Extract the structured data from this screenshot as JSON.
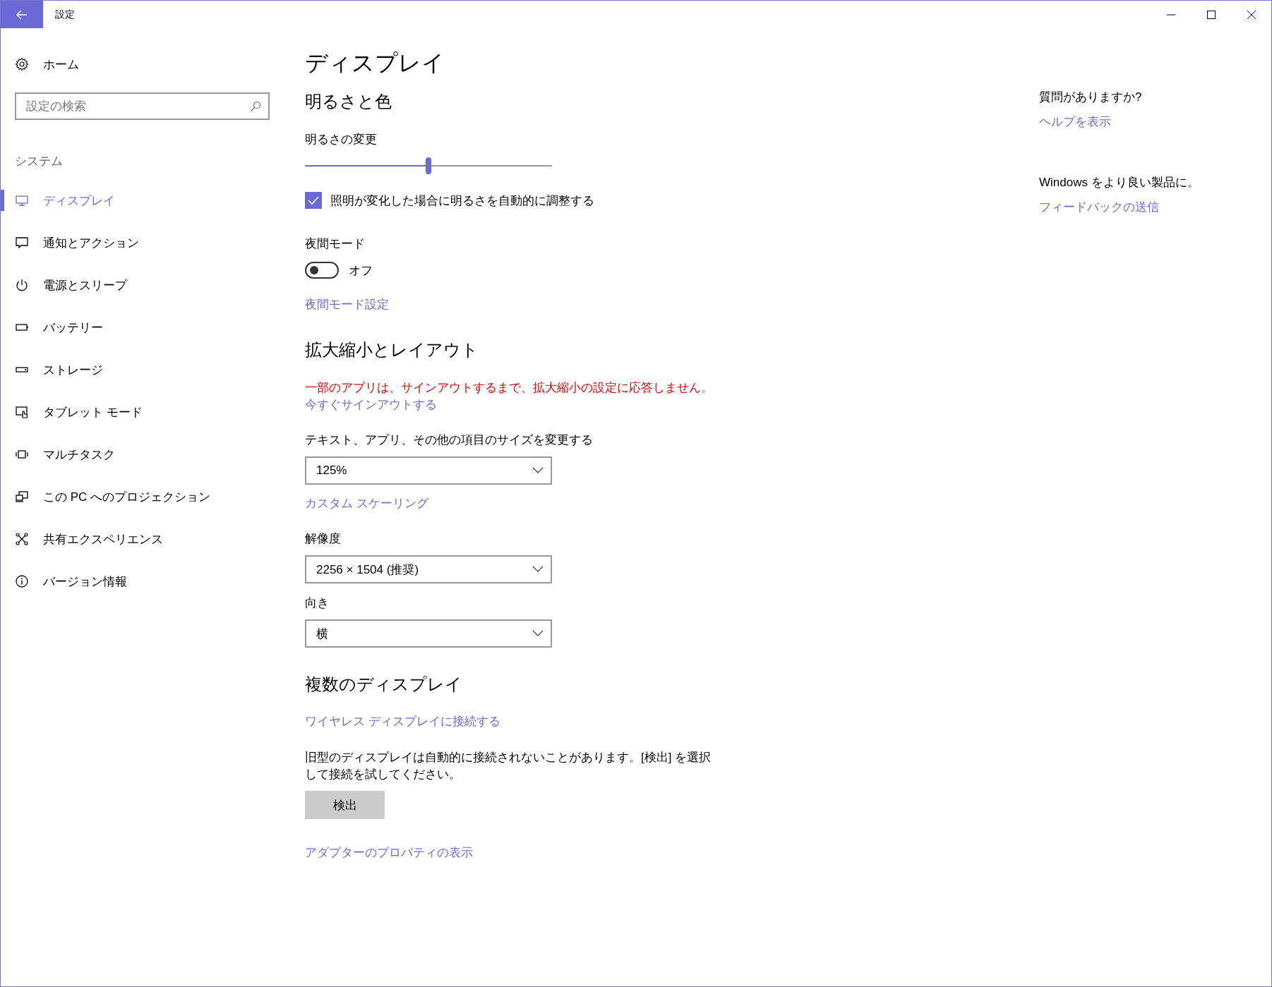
{
  "window": {
    "title": "設定"
  },
  "sidebar": {
    "home": "ホーム",
    "search": {
      "placeholder": "設定の検索"
    },
    "group_label": "システム",
    "items": [
      {
        "label": "ディスプレイ",
        "selected": true,
        "kind": "monitor"
      },
      {
        "label": "通知とアクション",
        "selected": false,
        "kind": "message"
      },
      {
        "label": "電源とスリープ",
        "selected": false,
        "kind": "power"
      },
      {
        "label": "バッテリー",
        "selected": false,
        "kind": "battery"
      },
      {
        "label": "ストレージ",
        "selected": false,
        "kind": "storage"
      },
      {
        "label": "タブレット モード",
        "selected": false,
        "kind": "tablet"
      },
      {
        "label": "マルチタスク",
        "selected": false,
        "kind": "multitask"
      },
      {
        "label": "この PC へのプロジェクション",
        "selected": false,
        "kind": "projection"
      },
      {
        "label": "共有エクスペリエンス",
        "selected": false,
        "kind": "share"
      },
      {
        "label": "バージョン情報",
        "selected": false,
        "kind": "info"
      }
    ]
  },
  "main": {
    "title": "ディスプレイ",
    "sections": [
      {
        "heading": "明るさと色",
        "items": [
          {
            "kind": "label",
            "text": "明るさの変更"
          },
          {
            "kind": "slider",
            "level": 0.5
          },
          {
            "kind": "checkbox",
            "text": "照明が変化した場合に明るさを自動的に調整する",
            "checked": true
          },
          {
            "kind": "label",
            "text": "夜間モード"
          },
          {
            "kind": "toggle",
            "text": "オフ",
            "on": false
          },
          {
            "kind": "link",
            "text": "夜間モード設定"
          }
        ]
      },
      {
        "heading": "拡大縮小とレイアウト",
        "items": [
          {
            "kind": "warning",
            "text": "一部のアプリは、サインアウトするまで、拡大縮小の設定に応答しません。"
          },
          {
            "kind": "link",
            "text": "今すぐサインアウトする"
          },
          {
            "kind": "label",
            "text": "テキスト、アプリ、その他の項目のサイズを変更する"
          },
          {
            "kind": "dropdown",
            "value": "125%"
          },
          {
            "kind": "link",
            "text": "カスタム スケーリング"
          },
          {
            "kind": "label",
            "text": "解像度"
          },
          {
            "kind": "dropdown",
            "value": "2256 × 1504 (推奨)"
          },
          {
            "kind": "label",
            "text": "向き"
          },
          {
            "kind": "dropdown",
            "value": "横"
          }
        ]
      },
      {
        "heading": "複数のディスプレイ",
        "items": [
          {
            "kind": "link",
            "text": "ワイヤレス ディスプレイに接続する"
          },
          {
            "kind": "paragraph",
            "text": "旧型のディスプレイは自動的に接続されないことがあります。[検出] を選択して接続を試してください。"
          },
          {
            "kind": "button",
            "text": "検出"
          },
          {
            "kind": "link",
            "text": "アダプターのプロパティの表示"
          }
        ]
      }
    ]
  },
  "aside": {
    "groups": [
      {
        "text": "質問がありますか?",
        "link": "ヘルプを表示"
      },
      {
        "text": "Windows をより良い製品に。",
        "link": "フィードバックの送信"
      }
    ]
  }
}
